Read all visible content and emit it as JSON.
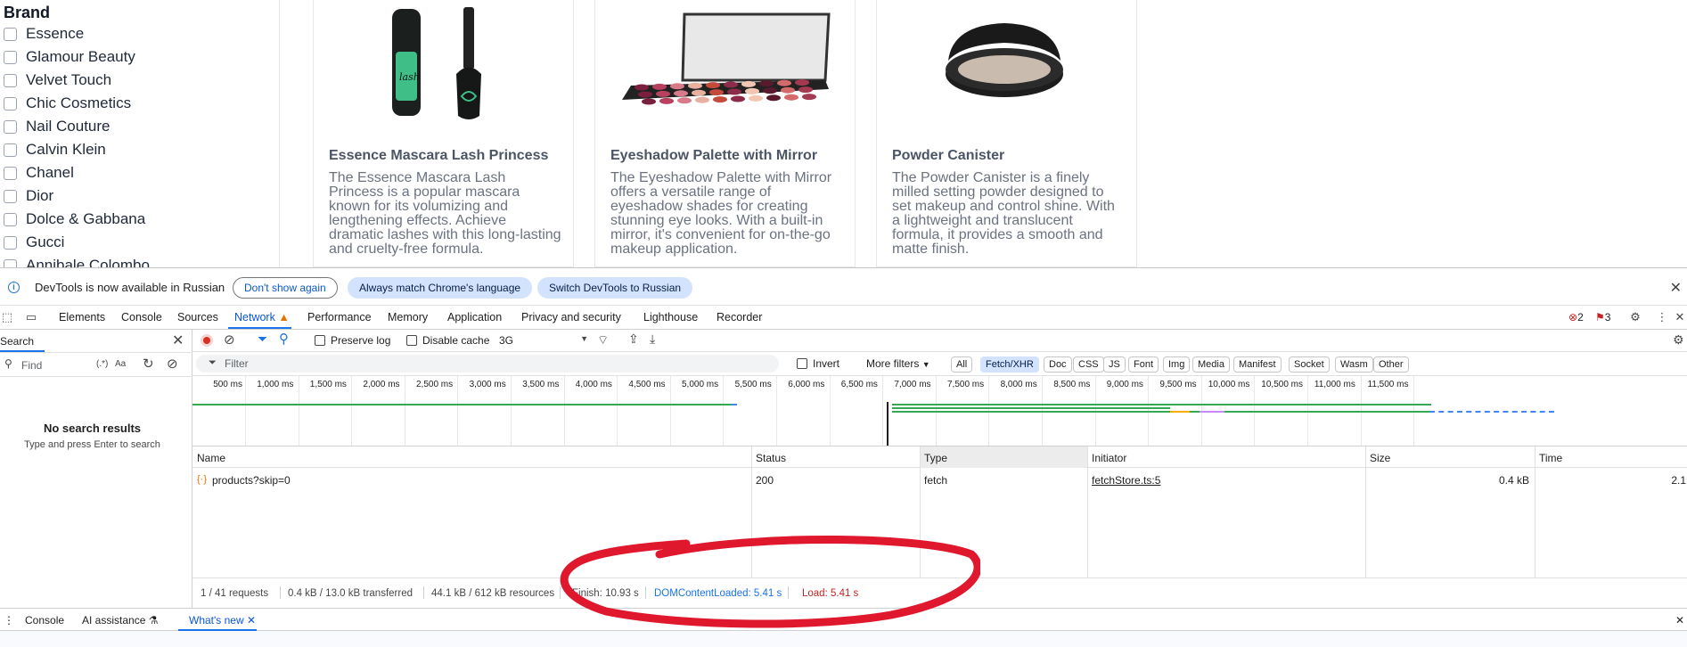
{
  "page": {
    "brand_title": "Brand",
    "brands": [
      "Essence",
      "Glamour Beauty",
      "Velvet Touch",
      "Chic Cosmetics",
      "Nail Couture",
      "Calvin Klein",
      "Chanel",
      "Dior",
      "Dolce & Gabbana",
      "Gucci",
      "Annibale Colombo"
    ],
    "products": [
      {
        "title": "Essence Mascara Lash Princess",
        "description": "The Essence Mascara Lash Princess is a popular mascara known for its volumizing and lengthening effects. Achieve dramatic lashes with this long-lasting and cruelty-free formula.",
        "icon": "mascara-image"
      },
      {
        "title": "Eyeshadow Palette with Mirror",
        "description": "The Eyeshadow Palette with Mirror offers a versatile range of eyeshadow shades for creating stunning eye looks. With a built-in mirror, it's convenient for on-the-go makeup application.",
        "icon": "eyeshadow-palette-image"
      },
      {
        "title": "Powder Canister",
        "description": "The Powder Canister is a finely milled setting powder designed to set makeup and control shine. With a lightweight and translucent formula, it provides a smooth and matte finish.",
        "icon": "powder-canister-image"
      }
    ]
  },
  "devtools": {
    "info_bar": {
      "message": "DevTools is now available in Russian",
      "dont_show": "Don't show again",
      "always_match": "Always match Chrome's language",
      "switch": "Switch DevTools to Russian"
    },
    "tabs": [
      "Elements",
      "Console",
      "Sources",
      "Network",
      "Performance",
      "Memory",
      "Application",
      "Privacy and security",
      "Lighthouse",
      "Recorder"
    ],
    "active_tab": "Network",
    "errors_count": "2",
    "warnings_count": "3",
    "search": {
      "label": "Search",
      "placeholder": "Find",
      "regex": "(.*)",
      "case": "Aa",
      "no_results": "No search results",
      "hint": "Type and press Enter to search"
    },
    "network_toolbar": {
      "preserve_log": "Preserve log",
      "disable_cache": "Disable cache",
      "throttling": "3G"
    },
    "filter": {
      "placeholder": "Filter",
      "invert": "Invert",
      "more_filters": "More filters",
      "types": [
        "All",
        "Fetch/XHR",
        "Doc",
        "CSS",
        "JS",
        "Font",
        "Img",
        "Media",
        "Manifest",
        "Socket",
        "Wasm",
        "Other"
      ],
      "active_type": "Fetch/XHR"
    },
    "overview_ticks": [
      "500 ms",
      "1,000 ms",
      "1,500 ms",
      "2,000 ms",
      "2,500 ms",
      "3,000 ms",
      "3,500 ms",
      "4,000 ms",
      "4,500 ms",
      "5,000 ms",
      "5,500 ms",
      "6,000 ms",
      "6,500 ms",
      "7,000 ms",
      "7,500 ms",
      "8,000 ms",
      "8,500 ms",
      "9,000 ms",
      "9,500 ms",
      "10,000 ms",
      "10,500 ms",
      "11,000 ms",
      "11,500 ms"
    ],
    "columns": [
      "Name",
      "Status",
      "Type",
      "Initiator",
      "Size",
      "Time"
    ],
    "rows": [
      {
        "name": "products?skip=0",
        "status": "200",
        "type": "fetch",
        "initiator": "fetchStore.ts:5",
        "size": "0.4 kB",
        "time": "2.1"
      }
    ],
    "status_bar": {
      "requests": "1 / 41 requests",
      "transferred": "0.4 kB / 13.0 kB transferred",
      "resources": "44.1 kB / 612 kB resources",
      "finish": "Finish: 10.93 s",
      "dcl": "DOMContentLoaded: 5.41 s",
      "load": "Load: 5.41 s"
    },
    "drawer_tabs": [
      "Console",
      "AI assistance",
      "What's new"
    ],
    "colors": {
      "accent": "#1a73e8",
      "dcl": "#1a73e8",
      "load": "#c5221f",
      "annotation": "#e0182d"
    }
  }
}
